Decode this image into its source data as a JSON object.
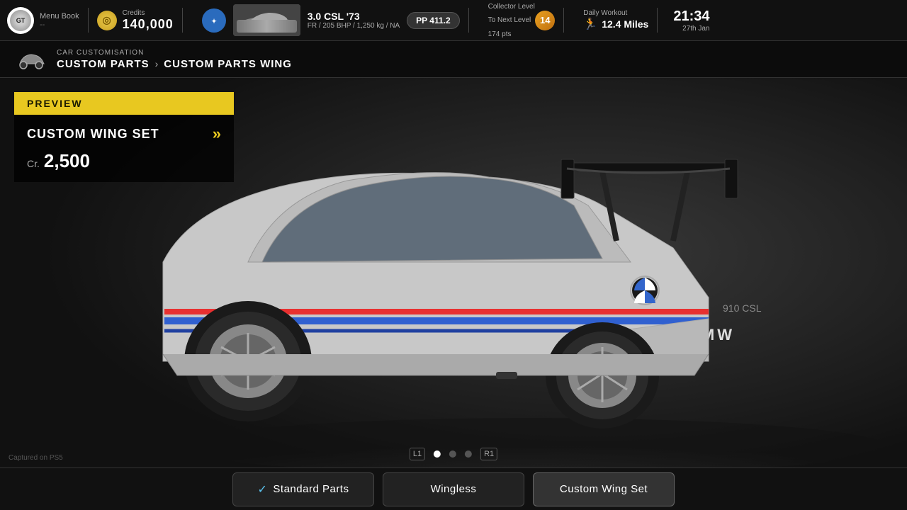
{
  "header": {
    "menu_book_label": "Menu Book",
    "menu_book_sub": "--",
    "credits_label": "Credits",
    "credits_amount": "140,000",
    "car_name": "3.0 CSL '73",
    "car_specs": "FR / 205 BHP / 1,250 kg / NA",
    "pp_badge": "PP 411.2",
    "collector_label": "Collector Level",
    "collector_next_level": "To Next Level",
    "collector_pts": "174 pts",
    "collector_level": "14",
    "daily_workout_label": "Daily Workout",
    "daily_workout_miles": "12.4 Miles",
    "time": "21:34",
    "date": "27th Jan"
  },
  "breadcrumb": {
    "section_label": "CAR CUSTOMISATION",
    "items": [
      {
        "label": "CUSTOM PARTS"
      },
      {
        "label": "CUSTOM PARTS WING"
      }
    ]
  },
  "preview": {
    "label": "PREVIEW",
    "wing_set_name": "CUSTOM WING SET",
    "price_cr": "Cr.",
    "price_amount": "2,500"
  },
  "carousel": {
    "dots": [
      {
        "active": true
      },
      {
        "active": false
      },
      {
        "active": false
      }
    ],
    "left_btn": "L1",
    "right_btn": "R1"
  },
  "wing_options": [
    {
      "label": "Standard Parts",
      "has_check": true,
      "active": false
    },
    {
      "label": "Wingless",
      "has_check": false,
      "active": false
    },
    {
      "label": "Custom Wing Set",
      "has_check": false,
      "active": true
    }
  ],
  "footer": {
    "captured_text": "Captured on PS5"
  }
}
